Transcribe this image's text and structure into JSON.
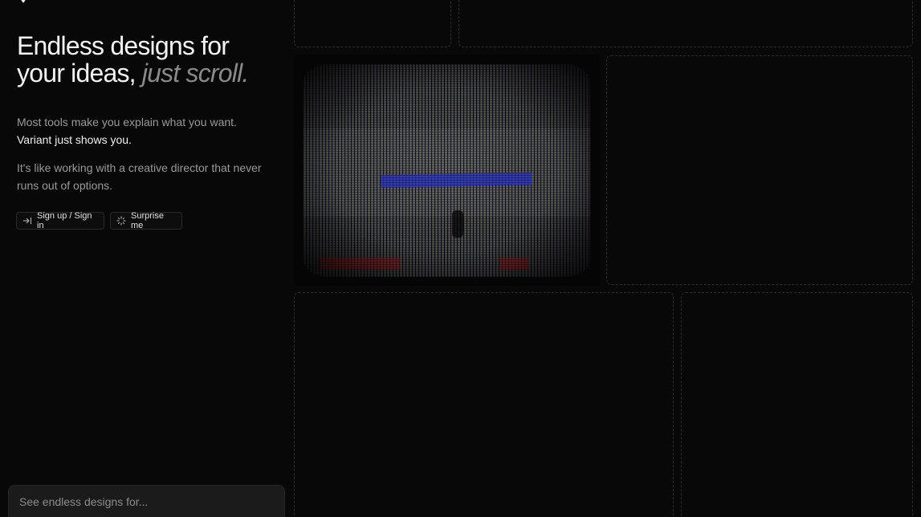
{
  "hero": {
    "title": "Endless designs for your ideas,",
    "title_accent": "just scroll."
  },
  "intro": {
    "p1_text": "Most tools make you explain what you want.",
    "p1_highlight": "Variant just shows you.",
    "p2_text": "It's like working with a creative director that never runs out of options."
  },
  "actions": {
    "signin_label": "Sign up / Sign in",
    "signin_icon": "arrow-right-to-bar-icon",
    "surprise_label": "Surprise me",
    "surprise_icon": "sparkle-icon"
  },
  "search": {
    "placeholder": "See endless designs for..."
  },
  "colors": {
    "background": "#080808",
    "accent_text": "#8a8a8a",
    "card_border": "#2c2c2c"
  }
}
